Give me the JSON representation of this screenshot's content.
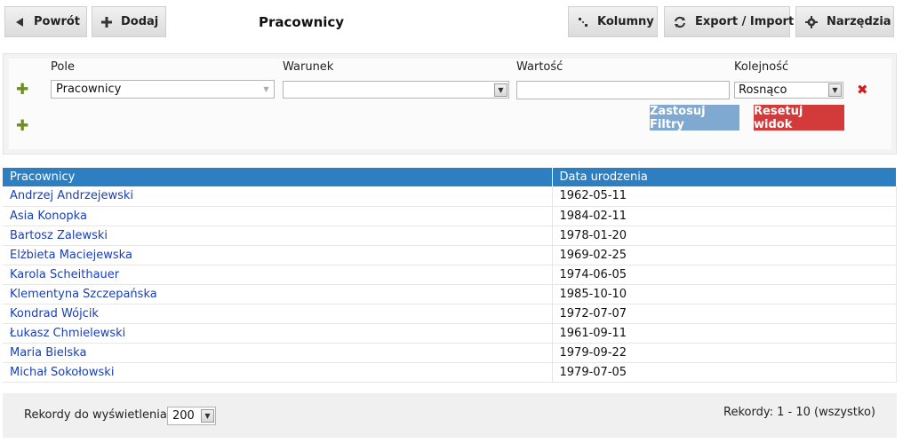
{
  "toolbar": {
    "back_label": "Powrót",
    "add_label": "Dodaj",
    "title": "Pracownicy",
    "columns_label": "Kolumny",
    "export_label": "Export / Import",
    "tools_label": "Narzędzia"
  },
  "filter": {
    "field_label": "Pole",
    "condition_label": "Warunek",
    "value_label": "Wartość",
    "order_label": "Kolejność",
    "field_value": "Pracownicy",
    "condition_value": "",
    "value_value": "",
    "order_value": "Rosnąco",
    "apply_label": "Zastosuj Filtry",
    "reset_label": "Resetuj widok"
  },
  "table": {
    "columns": [
      "Pracownicy",
      "Data urodzenia"
    ],
    "rows": [
      {
        "name": "Andrzej Andrzejewski",
        "date": "1962-05-11"
      },
      {
        "name": "Asia Konopka",
        "date": "1984-02-11"
      },
      {
        "name": "Bartosz Zalewski",
        "date": "1978-01-20"
      },
      {
        "name": "Elżbieta Maciejewska",
        "date": "1969-02-25"
      },
      {
        "name": "Karola Scheithauer",
        "date": "1974-06-05"
      },
      {
        "name": "Klementyna Szczepańska",
        "date": "1985-10-10"
      },
      {
        "name": "Kondrad Wójcik",
        "date": "1972-07-07"
      },
      {
        "name": "Łukasz Chmielewski",
        "date": "1961-09-11"
      },
      {
        "name": "Maria Bielska",
        "date": "1979-09-22"
      },
      {
        "name": "Michał Sokołowski",
        "date": "1979-07-05"
      }
    ]
  },
  "footer": {
    "records_label": "Rekordy do wyświetlenia:",
    "records_value": "200",
    "records_info": "Rekordy: 1 - 10 (wszystko)"
  },
  "colors": {
    "header_blue": "#2d7fc1",
    "apply_blue": "#7fa9d1",
    "reset_red": "#d33b3b",
    "link_blue": "#1a3fb5",
    "plus_green": "#6b8e23"
  }
}
